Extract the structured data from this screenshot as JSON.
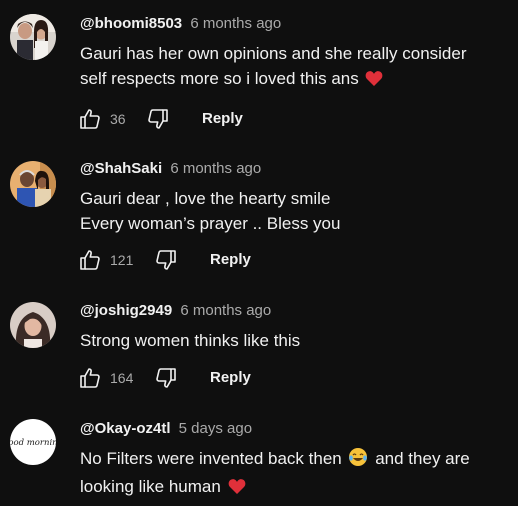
{
  "comments": [
    {
      "handle": "@bhoomi8503",
      "time": "6 months ago",
      "line1": "Gauri has her own opinions and she really consider",
      "line2": "self respects more so i loved this ans",
      "likes": "36",
      "reply": "Reply"
    },
    {
      "handle": "@ShahSaki",
      "time": "6 months ago",
      "line1": "Gauri dear , love the hearty smile",
      "line2": "Every woman’s prayer .. Bless you",
      "likes": "121",
      "reply": "Reply"
    },
    {
      "handle": "@joshig2949",
      "time": "6 months ago",
      "line1": "Strong women thinks like this",
      "likes": "164",
      "reply": "Reply"
    },
    {
      "handle": "@Okay-oz4tl",
      "time": "5 days ago",
      "line1a": "No Filters were invented back then",
      "line1b": "and they are",
      "line2": "looking like human",
      "avatar_text": "good morning"
    }
  ],
  "colors": {
    "background": "#0f0f0f",
    "text_primary": "#f1f1f1",
    "text_secondary": "#aaaaaa",
    "heart": "#e0303a"
  },
  "icons": {
    "like": "thumbs-up-icon",
    "dislike": "thumbs-down-icon",
    "heart": "red-heart-emoji",
    "laugh": "tears-of-joy-emoji"
  }
}
